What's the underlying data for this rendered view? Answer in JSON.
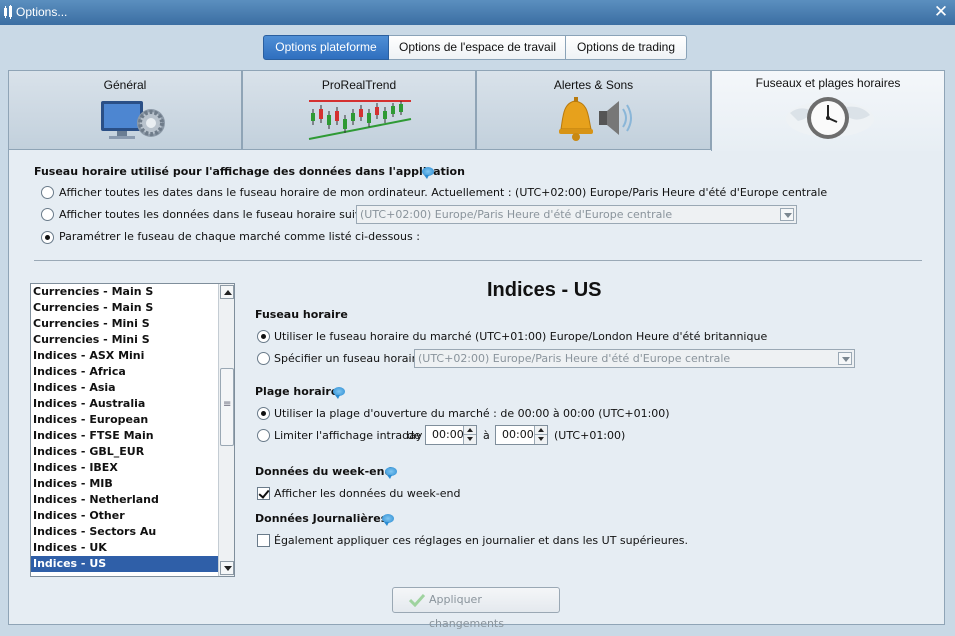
{
  "window": {
    "title": "Options...",
    "close_glyph": "✕"
  },
  "top_tabs": [
    {
      "label": "Options plateforme",
      "active": true
    },
    {
      "label": "Options de l'espace de travail",
      "active": false
    },
    {
      "label": "Options de trading",
      "active": false
    }
  ],
  "icon_tabs": [
    {
      "label": "Général",
      "icon": "monitor-gear-icon"
    },
    {
      "label": "ProRealTrend",
      "icon": "trend-chart-icon"
    },
    {
      "label": "Alertes & Sons",
      "icon": "bell-speaker-icon"
    },
    {
      "label": "Fuseaux et plages horaires",
      "icon": "world-clock-icon",
      "active": true
    }
  ],
  "global_tz": {
    "heading": "Fuseau horaire utilisé pour l'affichage des données dans l'application",
    "options": [
      "Afficher toutes les dates dans le fuseau horaire de mon ordinateur. Actuellement : (UTC+02:00) Europe/Paris Heure d'été d'Europe centrale",
      "Afficher toutes les données dans le fuseau horaire suivant :",
      "Paramétrer le fuseau de chaque marché comme listé ci-dessous :"
    ],
    "selected_index": 2,
    "select_value": "(UTC+02:00) Europe/Paris Heure d'été d'Europe centrale"
  },
  "market_list": {
    "items": [
      "Currencies - Main S",
      "Currencies - Main S",
      "Currencies - Mini S",
      "Currencies - Mini S",
      "Indices - ASX Mini",
      "Indices - Africa",
      "Indices - Asia",
      "Indices - Australia",
      "Indices - European",
      "Indices - FTSE Main",
      "Indices - GBL_EUR",
      "Indices - IBEX",
      "Indices - MIB",
      "Indices - Netherland",
      "Indices - Other",
      "Indices - Sectors Au",
      "Indices - UK",
      "Indices - US"
    ],
    "selected_index": 17
  },
  "detail": {
    "title": "Indices - US",
    "fuseau": {
      "heading": "Fuseau horaire",
      "option1": "Utiliser le fuseau horaire du marché (UTC+01:00) Europe/London Heure d'été britannique",
      "option2": "Spécifier un fuseau horaire :",
      "select_value": "(UTC+02:00) Europe/Paris Heure d'été d'Europe centrale"
    },
    "plage": {
      "heading": "Plage horaire",
      "option1": "Utiliser la plage d'ouverture du marché : de 00:00 à 00:00  (UTC+01:00)",
      "option2": "Limiter l'affichage intraday",
      "de": "de",
      "from_value": "00:00",
      "a": "à",
      "to_value": "00:00",
      "tz": "(UTC+01:00)"
    },
    "weekend": {
      "heading": "Données du week-end",
      "checkbox": "Afficher les données du week-end",
      "checked": true
    },
    "daily": {
      "heading": "Données Journalières",
      "checkbox": "Également appliquer ces réglages en journalier et dans les UT supérieures.",
      "checked": false
    }
  },
  "apply_label": "Appliquer changements",
  "colors": {
    "titlebar": "#3b6ea2",
    "active_tab": "#2f6fbf",
    "list_selection": "#2f5fa8",
    "panel_bg": "#e6edf3"
  }
}
